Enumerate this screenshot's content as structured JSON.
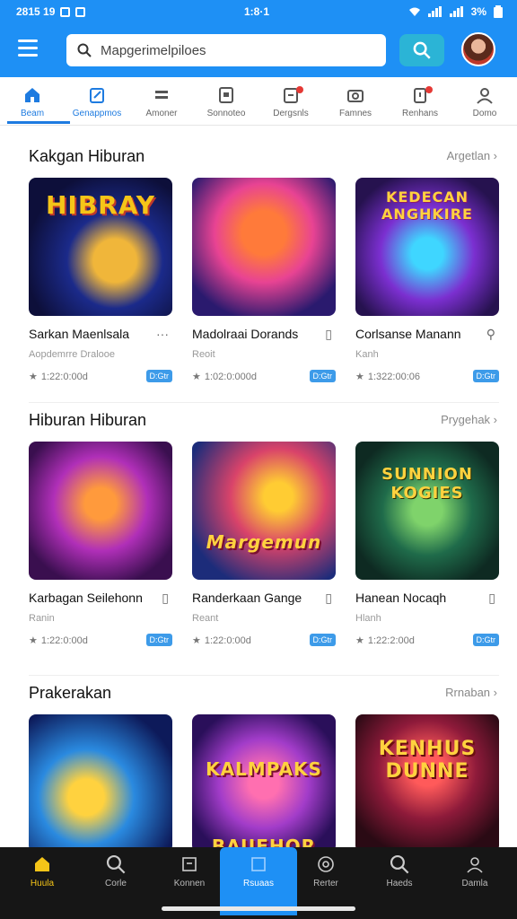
{
  "status_bar": {
    "time_left": "2815 19",
    "time_center": "1:8·1",
    "battery": "3%"
  },
  "search": {
    "value": "Mapgerimelpiloes",
    "placeholder": "Mapgerimelpiloes"
  },
  "nav_tabs": [
    {
      "label": "Beam",
      "icon": "home-icon",
      "active": true
    },
    {
      "label": "Genappmos",
      "icon": "edit-icon",
      "active": false
    },
    {
      "label": "Amoner",
      "icon": "grid-icon",
      "active": false
    },
    {
      "label": "Sonnoteo",
      "icon": "tag-icon",
      "active": false
    },
    {
      "label": "Dergsnls",
      "icon": "bag-icon",
      "active": false,
      "badge": true
    },
    {
      "label": "Famnes",
      "icon": "camera-icon",
      "active": false
    },
    {
      "label": "Renhans",
      "icon": "alert-icon",
      "active": false,
      "badge": true
    },
    {
      "label": "Domo",
      "icon": "person-icon",
      "active": false
    }
  ],
  "sections": [
    {
      "title": "Kakgan Hiburan",
      "link": "Argetlan",
      "cards": [
        {
          "title": "Sarkan Maenlsala",
          "sub": "Aopdemrre Dralooe",
          "rating": "1:22:0:00d",
          "badge": "D:Gtr",
          "art": "HIBRAY"
        },
        {
          "title": "Madolraai Dorands",
          "sub": "Reoit",
          "rating": "1:02:0:000d",
          "badge": "D:Gtr",
          "art": ""
        },
        {
          "title": "Corlsanse Manann",
          "sub": "Kanh",
          "rating": "1:322:00:06",
          "badge": "D:Gtr",
          "art": "KEDECAN ANGHKIRE"
        }
      ]
    },
    {
      "title": "Hiburan Hiburan",
      "link": "Prygehak",
      "cards": [
        {
          "title": "Karbagan Seilehonn",
          "sub": "Ranin",
          "rating": "1:22:0:00d",
          "badge": "D:Gtr",
          "art": ""
        },
        {
          "title": "Randerkaan Gange",
          "sub": "Reant",
          "rating": "1:22:0:00d",
          "badge": "D:Gtr",
          "art": "Margemun"
        },
        {
          "title": "Hanean Nocaqh",
          "sub": "Hlanh",
          "rating": "1:22:2:00d",
          "badge": "D:Gtr",
          "art": "SUNNION KOGIES"
        }
      ]
    },
    {
      "title": "Prakerakan",
      "link": "Rrnaban",
      "cards": [
        {
          "art": ""
        },
        {
          "art": "KALMPAKS BAUEHOR"
        },
        {
          "art": "KENHUS DUNNE"
        }
      ]
    }
  ],
  "bottom_nav": [
    {
      "label": "Huula",
      "icon": "home-icon"
    },
    {
      "label": "Corle",
      "icon": "search-icon"
    },
    {
      "label": "Konnen",
      "icon": "list-icon"
    },
    {
      "label": "Rsuaas",
      "icon": "square-icon",
      "active": true
    },
    {
      "label": "Rerter",
      "icon": "circle-icon"
    },
    {
      "label": "Haeds",
      "icon": "search-icon"
    },
    {
      "label": "Damla",
      "icon": "person-icon"
    }
  ],
  "colors": {
    "primary": "#1e90f5",
    "accent": "#2bb4d6",
    "badge": "#3d9be9",
    "nav_dark": "#161616"
  }
}
